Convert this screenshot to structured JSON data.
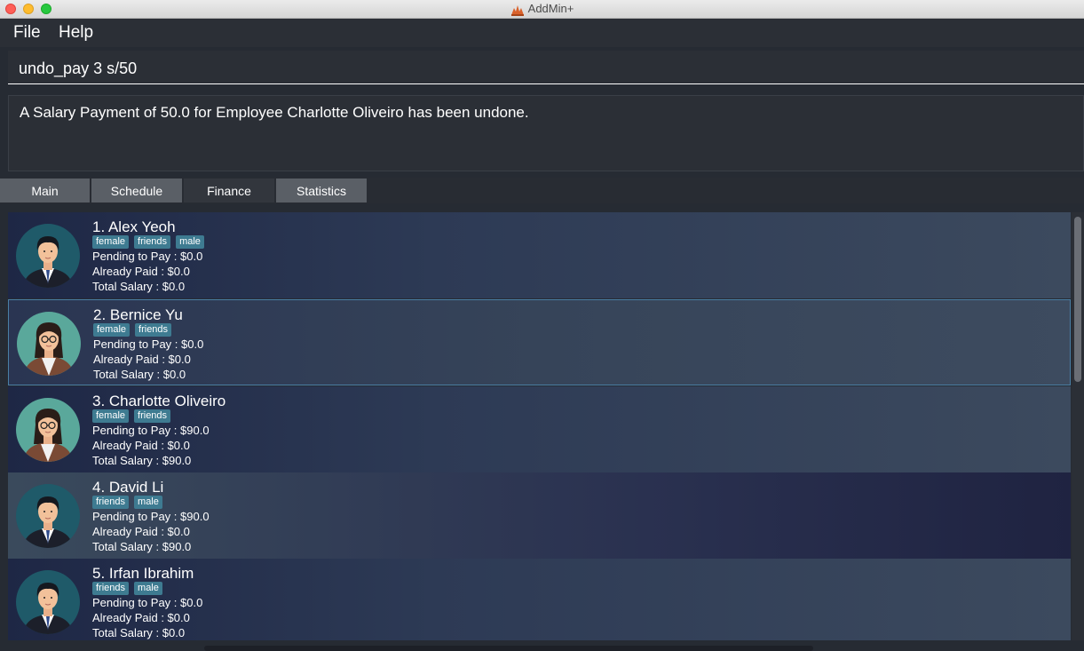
{
  "window": {
    "title": "AddMin+"
  },
  "menu": {
    "file": "File",
    "help": "Help"
  },
  "command_box": {
    "value": "undo_pay 3 s/50"
  },
  "result_box": {
    "text": "A Salary Payment of 50.0 for Employee Charlotte Oliveiro has been undone."
  },
  "tabs": [
    {
      "label": "Main"
    },
    {
      "label": "Schedule"
    },
    {
      "label": "Finance"
    },
    {
      "label": "Statistics"
    }
  ],
  "selected_tab": "Finance",
  "employees": [
    {
      "index_name": "1.  Alex Yeoh",
      "tags": [
        "female",
        "friends",
        "male"
      ],
      "pending": "Pending to Pay : $0.0",
      "paid": "Already Paid : $0.0",
      "total": "Total Salary : $0.0",
      "avatar": "male-avatar"
    },
    {
      "index_name": "2.  Bernice Yu",
      "tags": [
        "female",
        "friends"
      ],
      "pending": "Pending to Pay : $0.0",
      "paid": "Already Paid : $0.0",
      "total": "Total Salary : $0.0",
      "avatar": "female-avatar"
    },
    {
      "index_name": "3.  Charlotte Oliveiro",
      "tags": [
        "female",
        "friends"
      ],
      "pending": "Pending to Pay : $90.0",
      "paid": "Already Paid : $0.0",
      "total": "Total Salary : $90.0",
      "avatar": "female-avatar"
    },
    {
      "index_name": "4.  David Li",
      "tags": [
        "friends",
        "male"
      ],
      "pending": "Pending to Pay : $90.0",
      "paid": "Already Paid : $0.0",
      "total": "Total Salary : $90.0",
      "avatar": "male-avatar"
    },
    {
      "index_name": "5.  Irfan Ibrahim",
      "tags": [
        "friends",
        "male"
      ],
      "pending": "Pending to Pay : $0.0",
      "paid": "Already Paid : $0.0",
      "total": "Total Salary : $0.0",
      "avatar": "male-avatar"
    }
  ],
  "colors": {
    "accent": "#3e7b91",
    "selection_border": "#4a7fa5",
    "background": "#262b33"
  }
}
